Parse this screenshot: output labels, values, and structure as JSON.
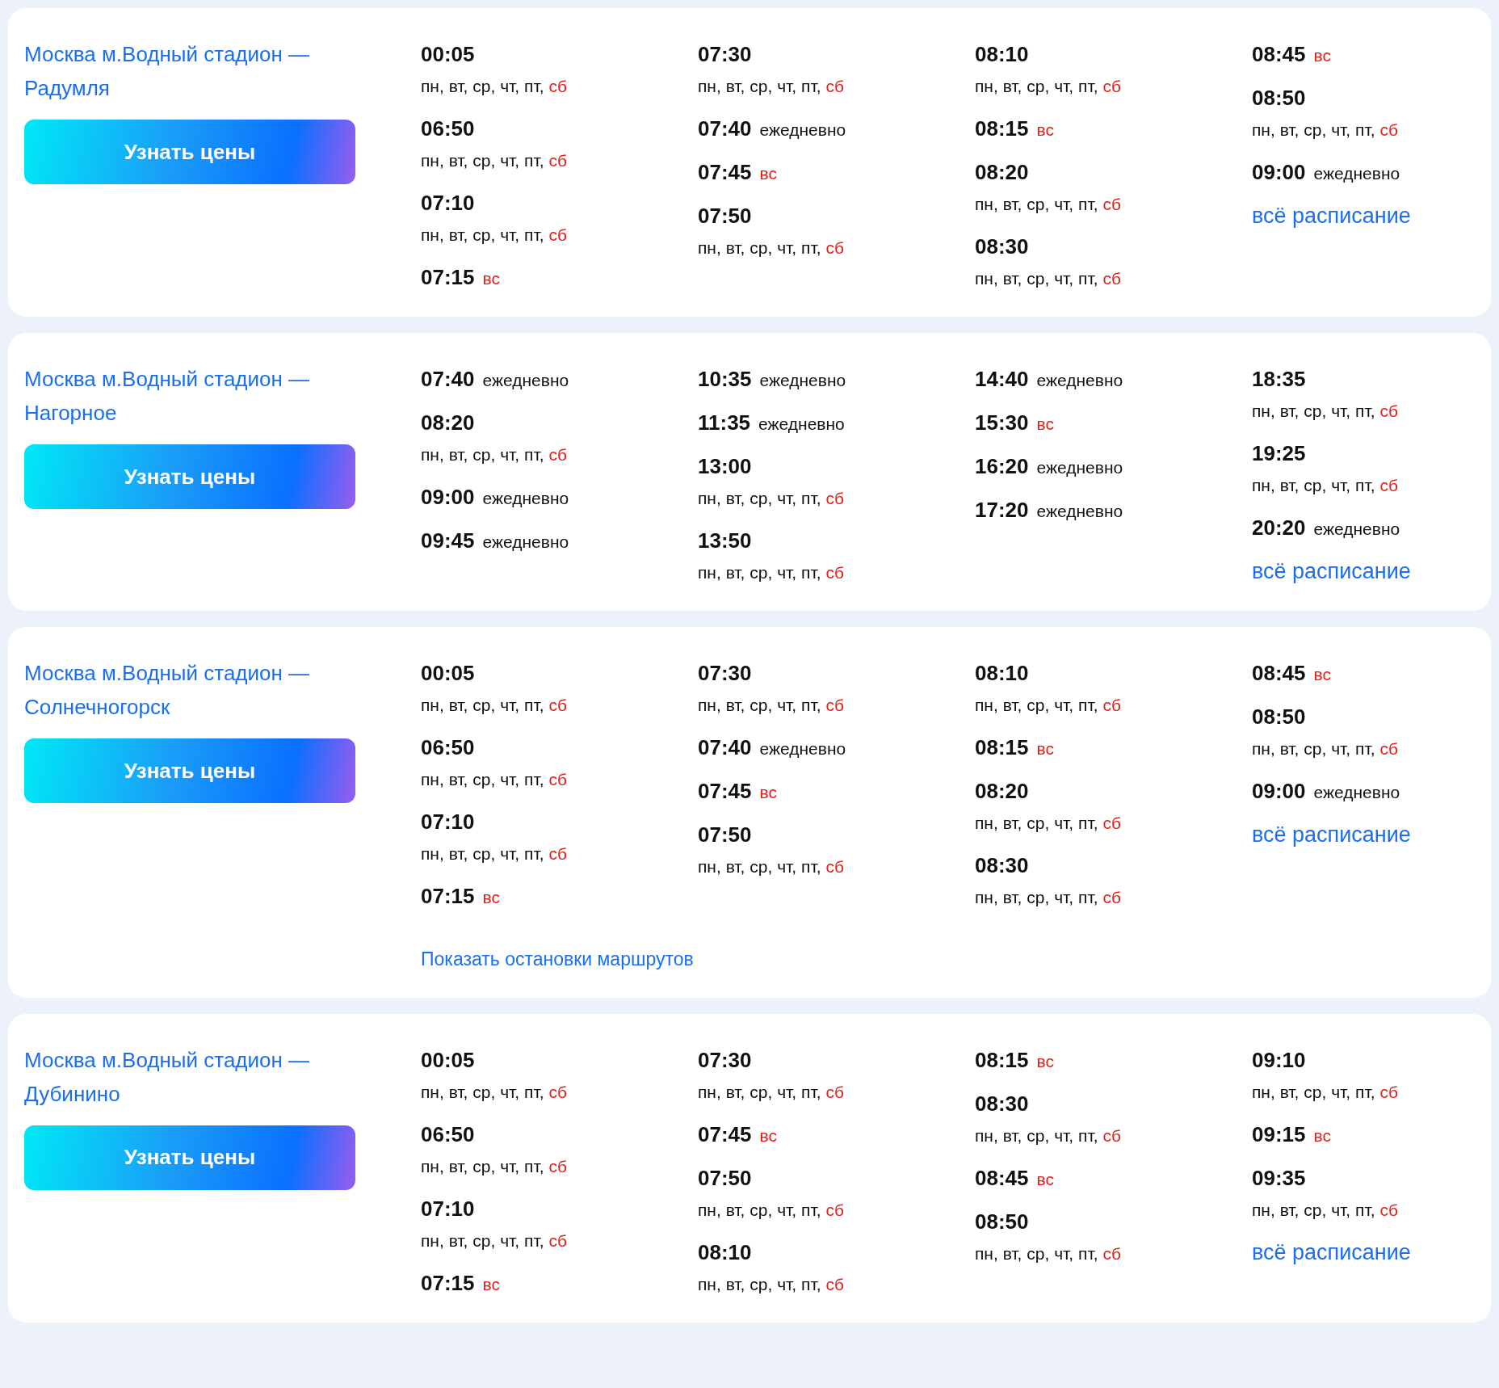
{
  "routes": [
    {
      "title": "Москва м.Водный стадион — Радумля",
      "button": "Узнать цены",
      "columns": [
        [
          {
            "time": "00:05",
            "kind": "multiline",
            "weekdays": "пн, вт, ср, чт, пт,",
            "weekend": "сб"
          },
          {
            "time": "06:50",
            "kind": "multiline",
            "weekdays": "пн, вт, ср, чт, пт,",
            "weekend": "сб"
          },
          {
            "time": "07:10",
            "kind": "multiline",
            "weekdays": "пн, вт, ср, чт, пт,",
            "weekend": "сб"
          },
          {
            "time": "07:15",
            "kind": "inline",
            "weekend": "вс"
          }
        ],
        [
          {
            "time": "07:30",
            "kind": "multiline",
            "weekdays": "пн, вт, ср, чт, пт,",
            "weekend": "сб"
          },
          {
            "time": "07:40",
            "kind": "inline",
            "weekdays": "ежедневно"
          },
          {
            "time": "07:45",
            "kind": "inline",
            "weekend": "вс"
          },
          {
            "time": "07:50",
            "kind": "multiline",
            "weekdays": "пн, вт, ср, чт, пт,",
            "weekend": "сб"
          }
        ],
        [
          {
            "time": "08:10",
            "kind": "multiline",
            "weekdays": "пн, вт, ср, чт, пт,",
            "weekend": "сб"
          },
          {
            "time": "08:15",
            "kind": "inline",
            "weekend": "вс"
          },
          {
            "time": "08:20",
            "kind": "multiline",
            "weekdays": "пн, вт, ср, чт, пт,",
            "weekend": "сб"
          },
          {
            "time": "08:30",
            "kind": "multiline",
            "weekdays": "пн, вт, ср, чт, пт,",
            "weekend": "сб"
          }
        ],
        [
          {
            "time": "08:45",
            "kind": "inline",
            "weekend": "вс"
          },
          {
            "time": "08:50",
            "kind": "multiline",
            "weekdays": "пн, вт, ср, чт, пт,",
            "weekend": "сб"
          },
          {
            "time": "09:00",
            "kind": "inline",
            "weekdays": "ежедневно"
          }
        ]
      ],
      "schedule_link": "всё расписание"
    },
    {
      "title": "Москва м.Водный стадион — Нагорное",
      "button": "Узнать цены",
      "columns": [
        [
          {
            "time": "07:40",
            "kind": "inline",
            "weekdays": "ежедневно"
          },
          {
            "time": "08:20",
            "kind": "multiline",
            "weekdays": "пн, вт, ср, чт, пт,",
            "weekend": "сб"
          },
          {
            "time": "09:00",
            "kind": "inline",
            "weekdays": "ежедневно"
          },
          {
            "time": "09:45",
            "kind": "inline",
            "weekdays": "ежедневно"
          }
        ],
        [
          {
            "time": "10:35",
            "kind": "inline",
            "weekdays": "ежедневно"
          },
          {
            "time": "11:35",
            "kind": "inline",
            "weekdays": "ежедневно"
          },
          {
            "time": "13:00",
            "kind": "multiline",
            "weekdays": "пн, вт, ср, чт, пт,",
            "weekend": "сб"
          },
          {
            "time": "13:50",
            "kind": "multiline",
            "weekdays": "пн, вт, ср, чт, пт,",
            "weekend": "сб"
          }
        ],
        [
          {
            "time": "14:40",
            "kind": "inline",
            "weekdays": "ежедневно"
          },
          {
            "time": "15:30",
            "kind": "inline",
            "weekend": "вс"
          },
          {
            "time": "16:20",
            "kind": "inline",
            "weekdays": "ежедневно"
          },
          {
            "time": "17:20",
            "kind": "inline",
            "weekdays": "ежедневно"
          }
        ],
        [
          {
            "time": "18:35",
            "kind": "multiline",
            "weekdays": "пн, вт, ср, чт, пт,",
            "weekend": "сб"
          },
          {
            "time": "19:25",
            "kind": "multiline",
            "weekdays": "пн, вт, ср, чт, пт,",
            "weekend": "сб"
          },
          {
            "time": "20:20",
            "kind": "inline",
            "weekdays": "ежедневно"
          }
        ]
      ],
      "schedule_link": "всё расписание"
    },
    {
      "title": "Москва м.Водный стадион — Солнечногорск",
      "button": "Узнать цены",
      "columns": [
        [
          {
            "time": "00:05",
            "kind": "multiline",
            "weekdays": "пн, вт, ср, чт, пт,",
            "weekend": "сб"
          },
          {
            "time": "06:50",
            "kind": "multiline",
            "weekdays": "пн, вт, ср, чт, пт,",
            "weekend": "сб"
          },
          {
            "time": "07:10",
            "kind": "multiline",
            "weekdays": "пн, вт, ср, чт, пт,",
            "weekend": "сб"
          },
          {
            "time": "07:15",
            "kind": "inline",
            "weekend": "вс"
          }
        ],
        [
          {
            "time": "07:30",
            "kind": "multiline",
            "weekdays": "пн, вт, ср, чт, пт,",
            "weekend": "сб"
          },
          {
            "time": "07:40",
            "kind": "inline",
            "weekdays": "ежедневно"
          },
          {
            "time": "07:45",
            "kind": "inline",
            "weekend": "вс"
          },
          {
            "time": "07:50",
            "kind": "multiline",
            "weekdays": "пн, вт, ср, чт, пт,",
            "weekend": "сб"
          }
        ],
        [
          {
            "time": "08:10",
            "kind": "multiline",
            "weekdays": "пн, вт, ср, чт, пт,",
            "weekend": "сб"
          },
          {
            "time": "08:15",
            "kind": "inline",
            "weekend": "вс"
          },
          {
            "time": "08:20",
            "kind": "multiline",
            "weekdays": "пн, вт, ср, чт, пт,",
            "weekend": "сб"
          },
          {
            "time": "08:30",
            "kind": "multiline",
            "weekdays": "пн, вт, ср, чт, пт,",
            "weekend": "сб"
          }
        ],
        [
          {
            "time": "08:45",
            "kind": "inline",
            "weekend": "вс"
          },
          {
            "time": "08:50",
            "kind": "multiline",
            "weekdays": "пн, вт, ср, чт, пт,",
            "weekend": "сб"
          },
          {
            "time": "09:00",
            "kind": "inline",
            "weekdays": "ежедневно"
          }
        ]
      ],
      "schedule_link": "всё расписание",
      "stops_link": "Показать остановки маршрутов"
    },
    {
      "title": "Москва м.Водный стадион — Дубинино",
      "button": "Узнать цены",
      "columns": [
        [
          {
            "time": "00:05",
            "kind": "multiline",
            "weekdays": "пн, вт, ср, чт, пт,",
            "weekend": "сб"
          },
          {
            "time": "06:50",
            "kind": "multiline",
            "weekdays": "пн, вт, ср, чт, пт,",
            "weekend": "сб"
          },
          {
            "time": "07:10",
            "kind": "multiline",
            "weekdays": "пн, вт, ср, чт, пт,",
            "weekend": "сб"
          },
          {
            "time": "07:15",
            "kind": "inline",
            "weekend": "вс"
          }
        ],
        [
          {
            "time": "07:30",
            "kind": "multiline",
            "weekdays": "пн, вт, ср, чт, пт,",
            "weekend": "сб"
          },
          {
            "time": "07:45",
            "kind": "inline",
            "weekend": "вс"
          },
          {
            "time": "07:50",
            "kind": "multiline",
            "weekdays": "пн, вт, ср, чт, пт,",
            "weekend": "сб"
          },
          {
            "time": "08:10",
            "kind": "multiline",
            "weekdays": "пн, вт, ср, чт, пт,",
            "weekend": "сб"
          }
        ],
        [
          {
            "time": "08:15",
            "kind": "inline",
            "weekend": "вс"
          },
          {
            "time": "08:30",
            "kind": "multiline",
            "weekdays": "пн, вт, ср, чт, пт,",
            "weekend": "сб"
          },
          {
            "time": "08:45",
            "kind": "inline",
            "weekend": "вс"
          },
          {
            "time": "08:50",
            "kind": "multiline",
            "weekdays": "пн, вт, ср, чт, пт,",
            "weekend": "сб"
          }
        ],
        [
          {
            "time": "09:10",
            "kind": "multiline",
            "weekdays": "пн, вт, ср, чт, пт,",
            "weekend": "сб"
          },
          {
            "time": "09:15",
            "kind": "inline",
            "weekend": "вс"
          },
          {
            "time": "09:35",
            "kind": "multiline",
            "weekdays": "пн, вт, ср, чт, пт,",
            "weekend": "сб"
          }
        ]
      ],
      "schedule_link": "всё расписание"
    }
  ]
}
